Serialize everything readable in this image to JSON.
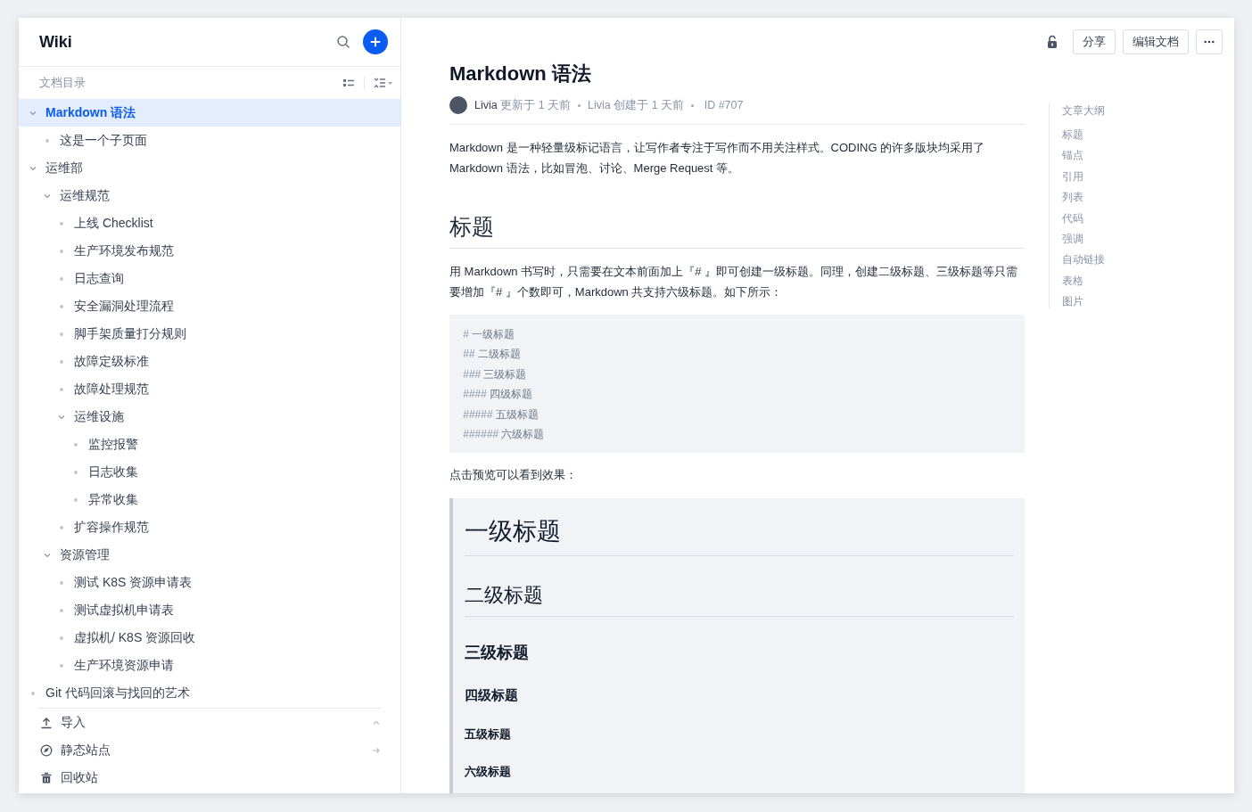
{
  "sidebar": {
    "title": "Wiki",
    "section_label": "文档目录",
    "tree": [
      {
        "label": "Markdown 语法",
        "selected": true,
        "expanded": true,
        "children": [
          {
            "label": "这是一个子页面",
            "selected": false
          }
        ]
      },
      {
        "label": "运维部",
        "selected": false,
        "expanded": true,
        "children": [
          {
            "label": "运维规范",
            "selected": false,
            "expanded": true,
            "children": [
              {
                "label": "上线 Checklist",
                "selected": false
              },
              {
                "label": "生产环境发布规范",
                "selected": false
              },
              {
                "label": "日志查询",
                "selected": false
              },
              {
                "label": "安全漏洞处理流程",
                "selected": false
              },
              {
                "label": "脚手架质量打分规则",
                "selected": false
              },
              {
                "label": "故障定级标准",
                "selected": false
              },
              {
                "label": "故障处理规范",
                "selected": false
              },
              {
                "label": "运维设施",
                "selected": false,
                "expanded": true,
                "children": [
                  {
                    "label": "监控报警",
                    "selected": false
                  },
                  {
                    "label": "日志收集",
                    "selected": false
                  },
                  {
                    "label": "异常收集",
                    "selected": false
                  }
                ]
              },
              {
                "label": "扩容操作规范",
                "selected": false
              }
            ]
          },
          {
            "label": "资源管理",
            "selected": false,
            "expanded": true,
            "children": [
              {
                "label": "测试 K8S 资源申请表",
                "selected": false
              },
              {
                "label": "测试虚拟机申请表",
                "selected": false
              },
              {
                "label": "虚拟机/ K8S 资源回收",
                "selected": false
              },
              {
                "label": "生产环境资源申请",
                "selected": false
              }
            ]
          }
        ]
      },
      {
        "label": "Git 代码回滚与找回的艺术",
        "selected": false
      }
    ],
    "footer_items": [
      {
        "label": "导入",
        "kind": "import"
      },
      {
        "label": "静态站点",
        "kind": "site"
      },
      {
        "label": "回收站",
        "kind": "trash"
      }
    ]
  },
  "toolbar": {
    "buttons": [
      "分享",
      "编辑文档"
    ]
  },
  "document": {
    "title": "Markdown 语法",
    "meta": [
      {
        "author": "Livia",
        "text": "更新于 1 天前"
      },
      {
        "author": "Livia",
        "text": "创建于 1 天前"
      },
      {
        "text": "ID #707"
      }
    ],
    "intro": "Markdown 是一种轻量级标记语言，让写作者专注于写作而不用关注样式。CODING 的许多版块均采用了 Markdown 语法，比如冒泡、讨论、Merge Request 等。",
    "section": {
      "heading": "标题",
      "paragraph": "用 Markdown 书写时，只需要在文本前面加上『# 』即可创建一级标题。同理，创建二级标题、三级标题等只需要增加『# 』个数即可，Markdown 共支持六级标题。如下所示：",
      "code_lines": [
        {
          "marks": "#",
          "text": "一级标题"
        },
        {
          "marks": "##",
          "text": "二级标题"
        },
        {
          "marks": "###",
          "text": "三级标题"
        },
        {
          "marks": "####",
          "text": "四级标题"
        },
        {
          "marks": "#####",
          "text": "五级标题"
        },
        {
          "marks": "######",
          "text": "六级标题"
        }
      ],
      "note": "点击预览可以看到效果：",
      "preview": [
        {
          "kind": "h1",
          "text": "一级标题"
        },
        {
          "kind": "h2",
          "text": "二级标题"
        },
        {
          "kind": "h3",
          "text": "三级标题"
        },
        {
          "kind": "h4",
          "text": "四级标题"
        },
        {
          "kind": "h5",
          "text": "五级标题"
        },
        {
          "kind": "h6",
          "text": "六级标题"
        }
      ]
    }
  },
  "outline": {
    "title": "文章大纲",
    "items": [
      "标题",
      "锚点",
      "引用",
      "列表",
      "代码",
      "强调",
      "自动链接",
      "表格",
      "图片"
    ]
  }
}
